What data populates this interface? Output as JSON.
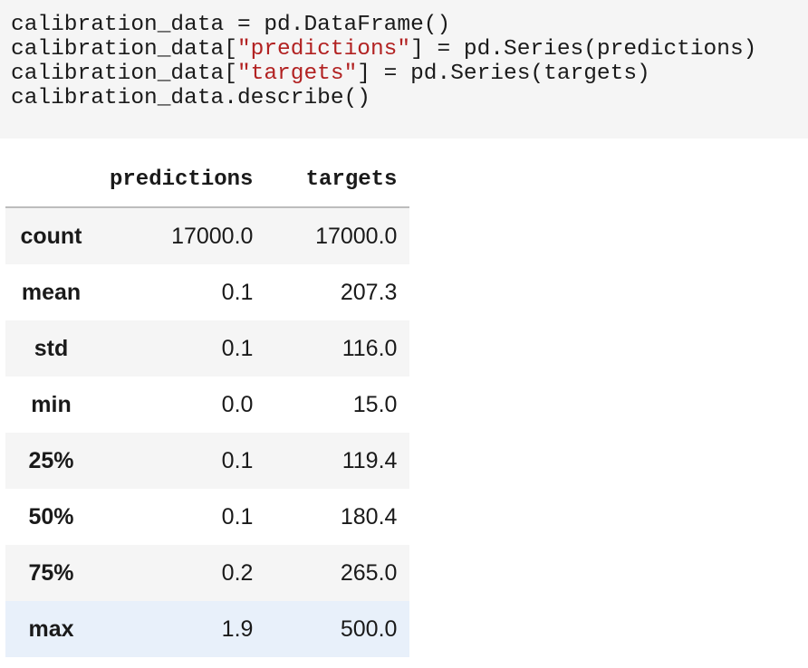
{
  "code_cell": {
    "lines": [
      [
        {
          "text": "calibration_data = pd.DataFrame()",
          "type": "plain"
        }
      ],
      [
        {
          "text": "calibration_data[",
          "type": "plain"
        },
        {
          "text": "\"predictions\"",
          "type": "string"
        },
        {
          "text": "] = pd.Series(predictions)",
          "type": "plain"
        }
      ],
      [
        {
          "text": "calibration_data[",
          "type": "plain"
        },
        {
          "text": "\"targets\"",
          "type": "string"
        },
        {
          "text": "] = pd.Series(targets)",
          "type": "plain"
        }
      ],
      [
        {
          "text": "calibration_data.describe()",
          "type": "plain"
        }
      ]
    ]
  },
  "output_table": {
    "columns": [
      "predictions",
      "targets"
    ],
    "rows": [
      {
        "index": "count",
        "values": [
          "17000.0",
          "17000.0"
        ]
      },
      {
        "index": "mean",
        "values": [
          "0.1",
          "207.3"
        ]
      },
      {
        "index": "std",
        "values": [
          "0.1",
          "116.0"
        ]
      },
      {
        "index": "min",
        "values": [
          "0.0",
          "15.0"
        ]
      },
      {
        "index": "25%",
        "values": [
          "0.1",
          "119.4"
        ]
      },
      {
        "index": "50%",
        "values": [
          "0.1",
          "180.4"
        ]
      },
      {
        "index": "75%",
        "values": [
          "0.2",
          "265.0"
        ]
      },
      {
        "index": "max",
        "values": [
          "1.9",
          "500.0"
        ]
      }
    ],
    "hovered_row": "max"
  },
  "colors": {
    "code_background": "#f5f5f5",
    "string_literal": "#b22222",
    "row_stripe": "#f5f5f5",
    "row_hover": "#e8f0fa"
  }
}
